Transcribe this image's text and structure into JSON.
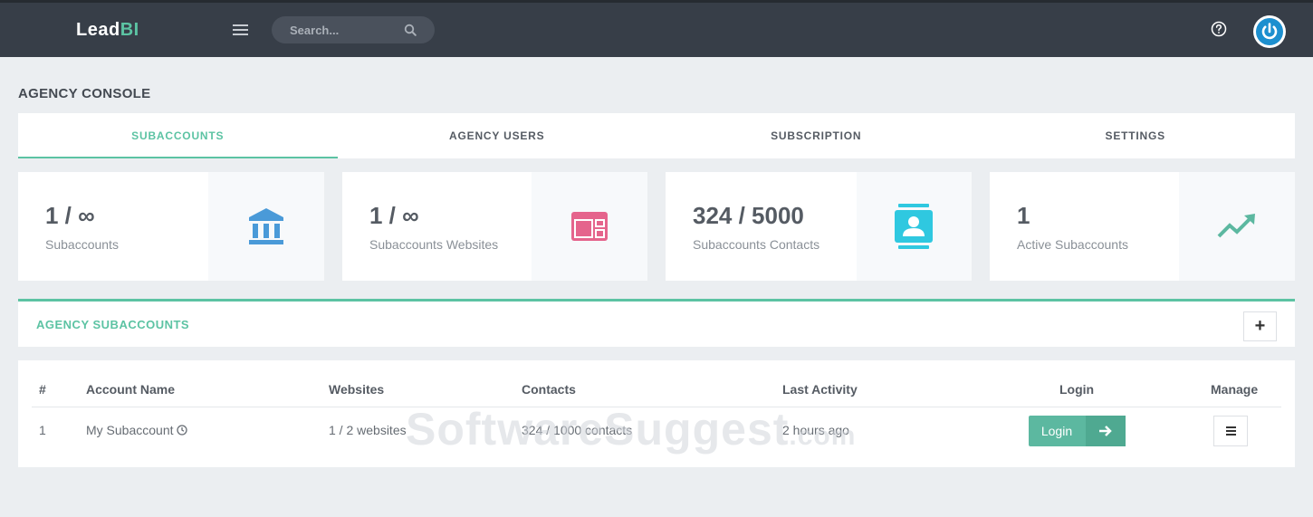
{
  "brand": {
    "name_part1": "Lead",
    "name_part2": "BI"
  },
  "topbar": {
    "search_placeholder": "Search..."
  },
  "page": {
    "title": "AGENCY CONSOLE"
  },
  "tabs": [
    {
      "label": "SUBACCOUNTS",
      "active": true
    },
    {
      "label": "AGENCY USERS",
      "active": false
    },
    {
      "label": "SUBSCRIPTION",
      "active": false
    },
    {
      "label": "SETTINGS",
      "active": false
    }
  ],
  "stats": [
    {
      "value": "1 / ∞",
      "label": "Subaccounts",
      "icon": "bank-icon",
      "color": "#4a9ad8"
    },
    {
      "value": "1 / ∞",
      "label": "Subaccounts Websites",
      "icon": "browser-window-icon",
      "color": "#e5648c"
    },
    {
      "value": "324 / 5000",
      "label": "Subaccounts Contacts",
      "icon": "contact-card-icon",
      "color": "#2fc8e0"
    },
    {
      "value": "1",
      "label": "Active Subaccounts",
      "icon": "trend-up-icon",
      "color": "#5cb8a0"
    }
  ],
  "panel": {
    "title": "AGENCY SUBACCOUNTS",
    "add_label": "+"
  },
  "table": {
    "headers": [
      "#",
      "Account Name",
      "Websites",
      "Contacts",
      "Last Activity",
      "Login",
      "Manage"
    ],
    "rows": [
      {
        "num": "1",
        "account_name": "My Subaccount",
        "websites": "1 / 2 websites",
        "contacts": "324 / 1000 contacts",
        "last_activity": "2 hours ago",
        "login_label": "Login"
      }
    ]
  },
  "watermark": {
    "main": "SoftwareSuggest",
    "suffix": ".com"
  },
  "colors": {
    "accent": "#5cc3a3",
    "topbar": "#373e48",
    "background": "#ebeef1"
  }
}
